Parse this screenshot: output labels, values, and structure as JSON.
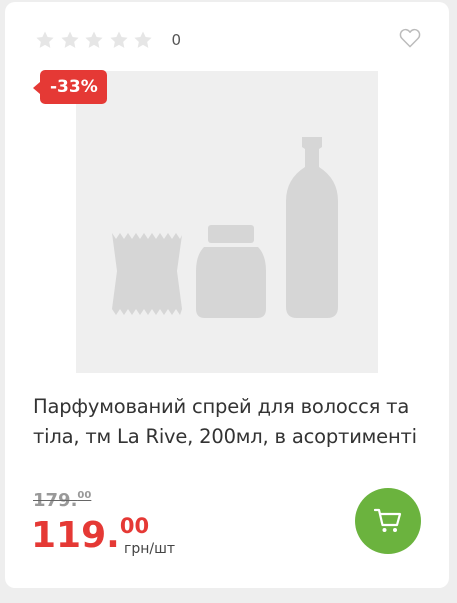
{
  "product": {
    "rating_count": "0",
    "discount_badge": "-33%",
    "title_line1": "Парфумований спрей для волосся та",
    "title_line2": "тіла, тм La Rive, 200мл, в асортименті",
    "old_price_int": "179.",
    "old_price_dec": "00",
    "price_int": "119.",
    "price_dec": "00",
    "unit": "грн/шт"
  },
  "rating": {
    "value": 0,
    "max": 5
  },
  "icons": {
    "star": "star-icon",
    "favorite": "heart-icon",
    "cart": "cart-icon",
    "placeholder": "product-placeholder-image"
  },
  "colors": {
    "accent_red": "#e53935",
    "cart_green": "#6bb33e",
    "star_empty": "#e6e6e6"
  }
}
